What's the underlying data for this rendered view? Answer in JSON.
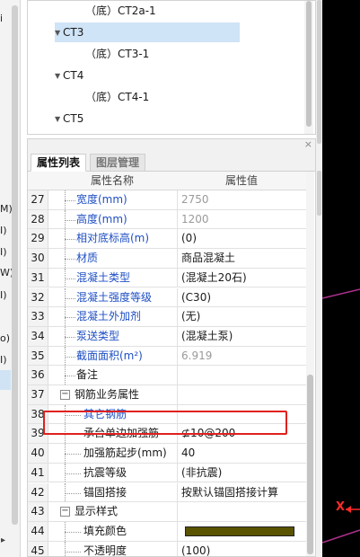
{
  "left_strip": {
    "labels": [
      "i",
      "M)",
      "I)",
      "I)",
      "W)",
      "I)",
      "o)",
      "I)"
    ]
  },
  "tree": {
    "nodes": [
      {
        "text": "（底）CT2a-1",
        "expanded": null
      },
      {
        "text": "CT3",
        "expanded": true,
        "selected": true
      },
      {
        "text": "（底）CT3-1",
        "expanded": null
      },
      {
        "text": "CT4",
        "expanded": true
      },
      {
        "text": "（底）CT4-1",
        "expanded": null
      },
      {
        "text": "CT5",
        "expanded": true
      }
    ]
  },
  "panel": {
    "close_glyph": "×",
    "tabs": [
      {
        "label": "属性列表",
        "active": true
      },
      {
        "label": "图层管理",
        "active": false
      }
    ],
    "header": {
      "name": "属性名称",
      "value": "属性值"
    }
  },
  "rows": [
    {
      "num": "27",
      "name": "宽度(mm)",
      "value": "2750",
      "name_style": "blue",
      "value_style": "gray"
    },
    {
      "num": "28",
      "name": "高度(mm)",
      "value": "1200",
      "name_style": "blue",
      "value_style": "gray"
    },
    {
      "num": "29",
      "name": "相对底标高(m)",
      "value": "(0)",
      "name_style": "blue",
      "value_style": ""
    },
    {
      "num": "30",
      "name": "材质",
      "value": "商品混凝土",
      "name_style": "blue",
      "value_style": ""
    },
    {
      "num": "31",
      "name": "混凝土类型",
      "value": "(混凝土20石)",
      "name_style": "blue",
      "value_style": ""
    },
    {
      "num": "32",
      "name": "混凝土强度等级",
      "value": "(C30)",
      "name_style": "blue",
      "value_style": ""
    },
    {
      "num": "33",
      "name": "混凝土外加剂",
      "value": "(无)",
      "name_style": "blue",
      "value_style": ""
    },
    {
      "num": "34",
      "name": "泵送类型",
      "value": "(混凝土泵)",
      "name_style": "blue",
      "value_style": ""
    },
    {
      "num": "35",
      "name": "截面面积(m²)",
      "value": "6.919",
      "name_style": "blue",
      "value_style": "gray"
    },
    {
      "num": "36",
      "name": "备注",
      "value": "",
      "name_style": "",
      "value_style": ""
    },
    {
      "num": "37",
      "name": "钢筋业务属性",
      "value": "",
      "name_style": "",
      "value_style": "",
      "group": "minus"
    },
    {
      "num": "38",
      "name": "其它钢筋",
      "value": "",
      "name_style": "blue",
      "value_style": ""
    },
    {
      "num": "39",
      "name": "承台单边加强筋",
      "value": "⊈10@200",
      "name_style": "",
      "value_style": ""
    },
    {
      "num": "40",
      "name": "加强筋起步(mm)",
      "value": "40",
      "name_style": "",
      "value_style": ""
    },
    {
      "num": "41",
      "name": "抗震等级",
      "value": "(非抗震)",
      "name_style": "",
      "value_style": ""
    },
    {
      "num": "42",
      "name": "锚固搭接",
      "value": "按默认锚固搭接计算",
      "name_style": "",
      "value_style": ""
    },
    {
      "num": "43",
      "name": "显示样式",
      "value": "",
      "name_style": "",
      "value_style": "",
      "group": "minus"
    },
    {
      "num": "44",
      "name": "填充颜色",
      "value": "",
      "name_style": "",
      "value_style": "",
      "swatch": "#5a5300"
    },
    {
      "num": "45",
      "name": "不透明度",
      "value": "(100)",
      "name_style": "",
      "value_style": ""
    }
  ],
  "highlight_color": "#e0201e",
  "canvas": {
    "axis_label": "X"
  }
}
